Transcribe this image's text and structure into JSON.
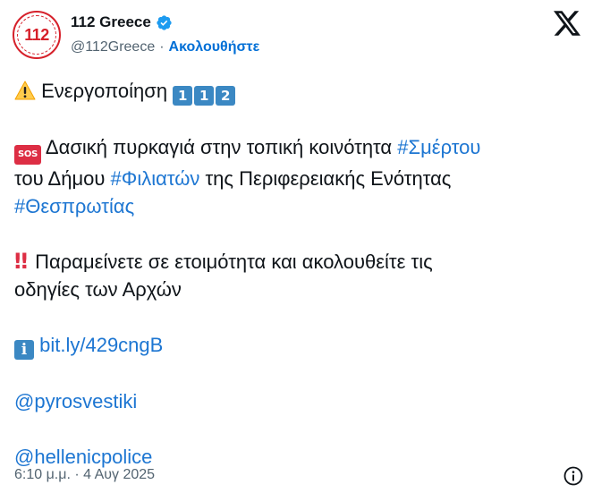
{
  "header": {
    "avatar_text": "112",
    "display_name": "112 Greece",
    "handle": "@112Greece",
    "separator": "·",
    "follow_label": "Ακολουθήστε"
  },
  "tweet": {
    "line1_text": "Ενεργοποίηση",
    "line1_keycaps": [
      "1",
      "1",
      "2"
    ],
    "sos_label": "SOS",
    "line2_text": " Δασική πυρκαγιά στην τοπική κοινότητα ",
    "line2_tag": "#Σμέρτου",
    "line3_pre": "του Δήμου ",
    "line3_tag": "#Φιλιατών",
    "line3_post": " της Περιφερειακής Ενότητας",
    "line4_tag": "#Θεσπρωτίας",
    "bang": "‼",
    "line5_text": " Παραμείνετε σε ετοιμότητα και ακολουθείτε τις",
    "line6_text": "οδηγίες των Αρχών",
    "info_glyph": "i",
    "link_url": "bit.ly/429cngB",
    "mention1": "@pyrosvestiki",
    "mention2": "@hellenicpolice"
  },
  "footer": {
    "timestamp": "6:10 μ.μ. · 4 Αυγ 2025"
  },
  "icons": {
    "warning": "warning-icon",
    "sos": "sos-icon",
    "info": "info-icon",
    "x_logo": "x-logo-icon",
    "verified": "verified-badge-icon"
  },
  "colors": {
    "link": "#1d76d2",
    "follow": "#006fd6",
    "muted": "#536471",
    "keycap": "#3b88c3",
    "alert_red": "#dd2e44",
    "brand_red": "#d6202a"
  }
}
